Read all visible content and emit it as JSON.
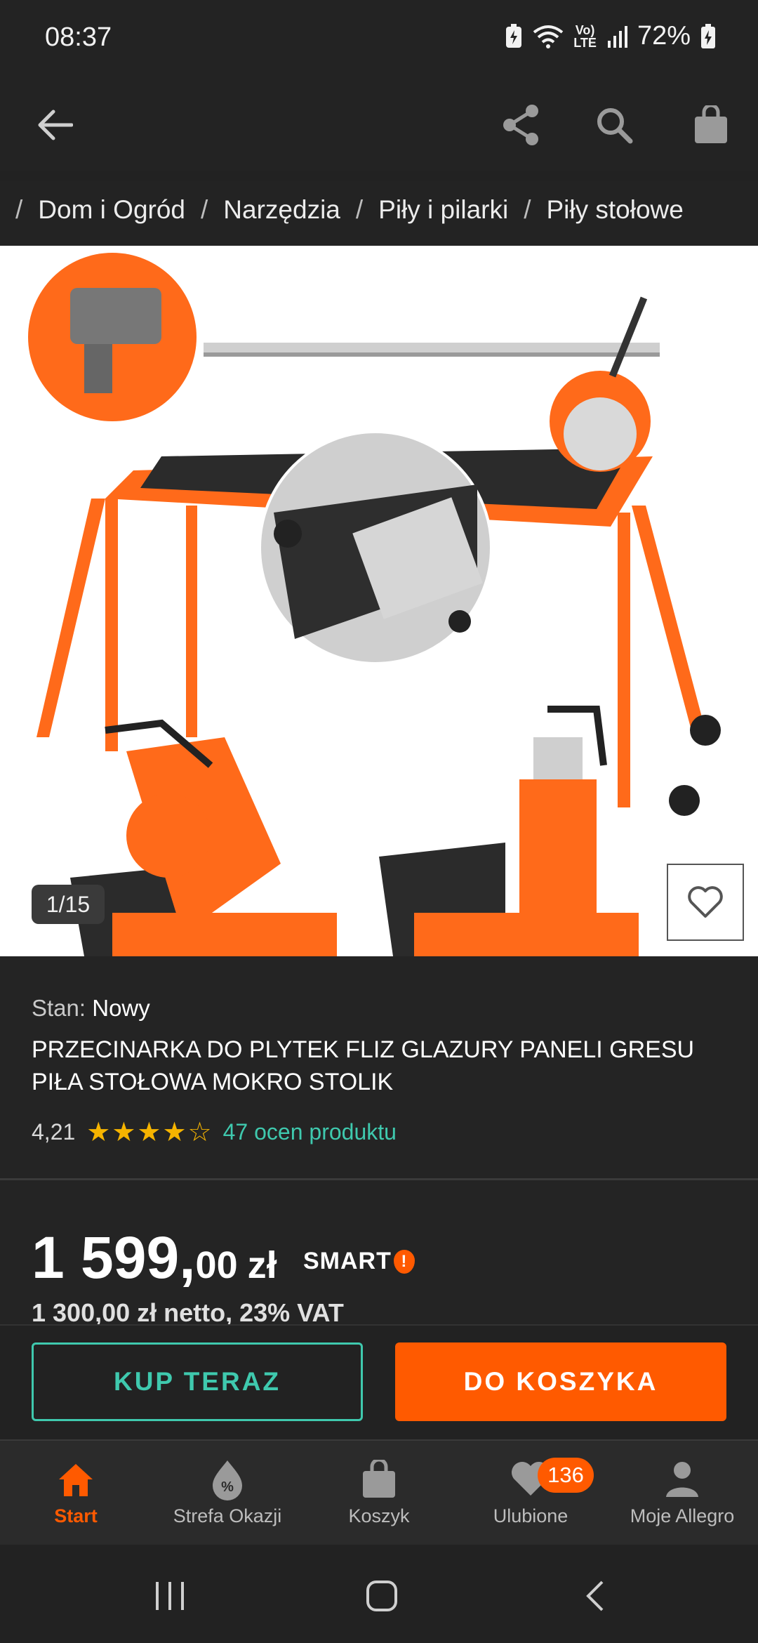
{
  "status_bar": {
    "time": "08:37",
    "battery": "72%",
    "volte_top": "Vo)",
    "volte_bottom": "LTE"
  },
  "breadcrumb": {
    "items": [
      "Dom i Ogród",
      "Narzędzia",
      "Piły i pilarki",
      "Piły stołowe"
    ]
  },
  "gallery": {
    "counter": "1/15"
  },
  "product": {
    "condition_label": "Stan:",
    "condition_value": "Nowy",
    "title": "PRZECINARKA DO PLYTEK FLIZ GLAZURY PANELI GRESU PIŁA STOŁOWA MOKRO STOLIK",
    "rating_value": "4,21",
    "rating_stars": 4.21,
    "rating_stars_text": "★★★★☆",
    "reviews_link": "47 ocen produktu"
  },
  "price": {
    "main": "1 599,",
    "cents": "00",
    "currency": "zł",
    "smart_label": "SMART",
    "smart_mark": "!",
    "netto_text": "1 300,00 zł netto, 23% VAT"
  },
  "actions": {
    "buy_now": "KUP TERAZ",
    "add_to_cart": "DO KOSZYKA"
  },
  "bottom_nav": {
    "items": [
      {
        "label": "Start",
        "active": true
      },
      {
        "label": "Strefa Okazji",
        "active": false
      },
      {
        "label": "Koszyk",
        "active": false
      },
      {
        "label": "Ulubione",
        "active": false,
        "badge": "136"
      },
      {
        "label": "Moje Allegro",
        "active": false
      }
    ]
  },
  "colors": {
    "accent": "#ff5a00",
    "teal": "#3fc9ae",
    "star": "#f6b400",
    "background": "#222222"
  }
}
